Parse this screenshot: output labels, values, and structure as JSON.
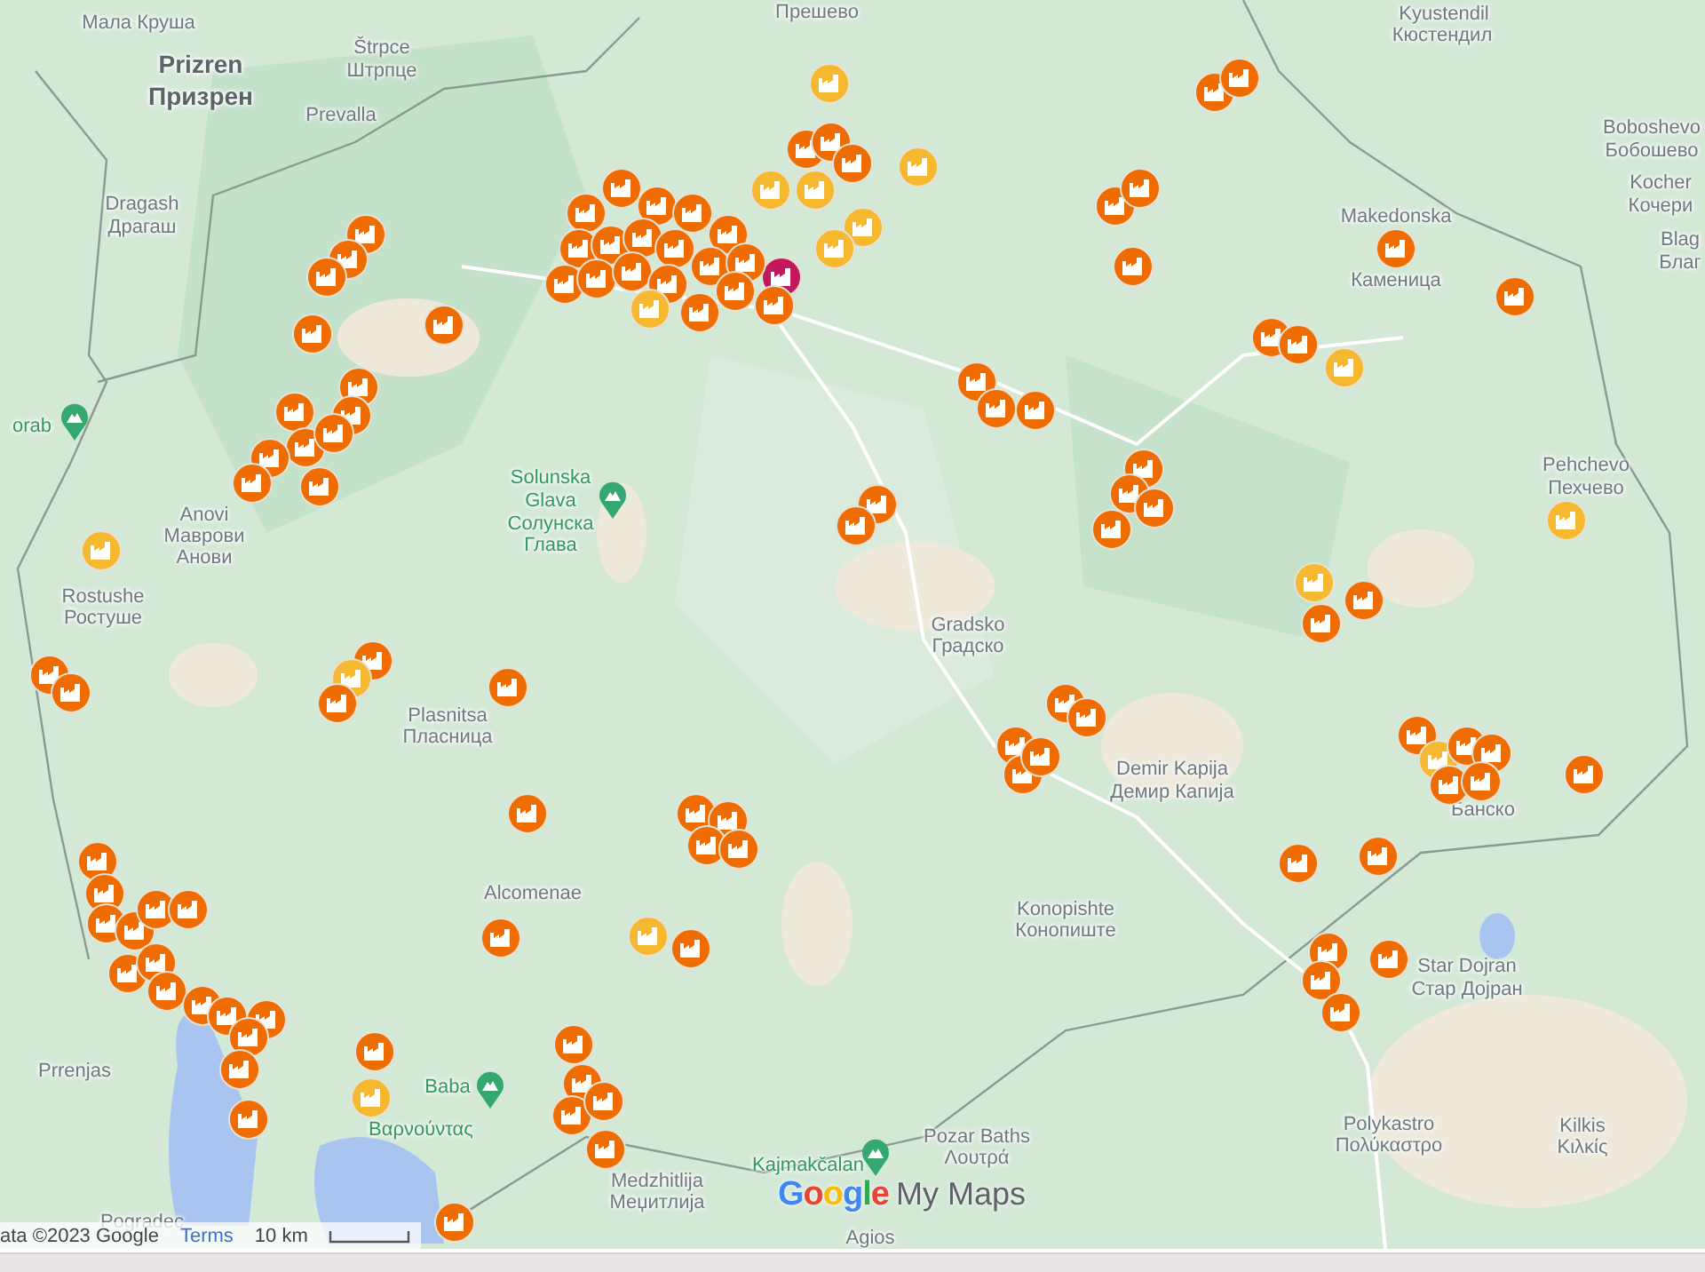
{
  "map": {
    "labels": [
      {
        "text": "Мала Круша",
        "kind": "town"
      },
      {
        "text": "Prizren",
        "kind": "city"
      },
      {
        "text": "Призрен",
        "kind": "city"
      },
      {
        "text": "Štrpce",
        "kind": "town"
      },
      {
        "text": "Штрпце",
        "kind": "town"
      },
      {
        "text": "Prevalla",
        "kind": "town"
      },
      {
        "text": "Прешево",
        "kind": "town"
      },
      {
        "text": "Dragash",
        "kind": "town"
      },
      {
        "text": "Драгаш",
        "kind": "town"
      },
      {
        "text": "orab",
        "kind": "peak"
      },
      {
        "text": "Anovi",
        "kind": "town"
      },
      {
        "text": "Маврови",
        "kind": "town"
      },
      {
        "text": "Анови",
        "kind": "town"
      },
      {
        "text": "Rostushe",
        "kind": "town"
      },
      {
        "text": "Ростуше",
        "kind": "town"
      },
      {
        "text": "Solunska",
        "kind": "peak"
      },
      {
        "text": "Glava",
        "kind": "peak"
      },
      {
        "text": "Солунска",
        "kind": "peak"
      },
      {
        "text": "Глава",
        "kind": "peak"
      },
      {
        "text": "Gradsko",
        "kind": "town"
      },
      {
        "text": "Градско",
        "kind": "town"
      },
      {
        "text": "Plasnitsa",
        "kind": "town"
      },
      {
        "text": "Пласница",
        "kind": "town"
      },
      {
        "text": "Alcomenae",
        "kind": "town"
      },
      {
        "text": "Konopishte",
        "kind": "town"
      },
      {
        "text": "Конопиште",
        "kind": "town"
      },
      {
        "text": "Demir Kapija",
        "kind": "town"
      },
      {
        "text": "Демир Капија",
        "kind": "town"
      },
      {
        "text": "Star Dojran",
        "kind": "town"
      },
      {
        "text": "Стар Дојран",
        "kind": "town"
      },
      {
        "text": "Polykastro",
        "kind": "town"
      },
      {
        "text": "Πολύκαστρο",
        "kind": "town"
      },
      {
        "text": "Kilkis",
        "kind": "town"
      },
      {
        "text": "Κιλκίς",
        "kind": "town"
      },
      {
        "text": "Kyustendil",
        "kind": "town"
      },
      {
        "text": "Кюстендил",
        "kind": "town"
      },
      {
        "text": "Boboshevo",
        "kind": "town"
      },
      {
        "text": "Бобошево",
        "kind": "town"
      },
      {
        "text": "Kocher",
        "kind": "town"
      },
      {
        "text": "Кочери",
        "kind": "town"
      },
      {
        "text": "Blag",
        "kind": "town"
      },
      {
        "text": "Благ",
        "kind": "town"
      },
      {
        "text": "Makedonska",
        "kind": "town"
      },
      {
        "text": "Каменица",
        "kind": "town"
      },
      {
        "text": "Pehchevo",
        "kind": "town"
      },
      {
        "text": "Пехчево",
        "kind": "town"
      },
      {
        "text": "Банско",
        "kind": "town"
      },
      {
        "text": "Prrenjas",
        "kind": "town"
      },
      {
        "text": "Pogradec",
        "kind": "town"
      },
      {
        "text": "Medzhitlija",
        "kind": "town"
      },
      {
        "text": "Меџитлија",
        "kind": "town"
      },
      {
        "text": "Kajmakčalan",
        "kind": "peak"
      },
      {
        "text": "Pozar Baths",
        "kind": "town"
      },
      {
        "text": "Λουτρά",
        "kind": "town"
      },
      {
        "text": "Agios",
        "kind": "town"
      },
      {
        "text": "Baba",
        "kind": "peak"
      },
      {
        "text": "Βαρνούντας",
        "kind": "peak"
      }
    ],
    "markers": [
      {
        "color": "#f5b82e"
      },
      {
        "color": "#ef6c00"
      },
      {
        "color": "#ef6c00"
      },
      {
        "color": "#ef6c00"
      },
      {
        "color": "#ef6c00"
      },
      {
        "color": "#ef6c00"
      },
      {
        "color": "#f5b82e"
      },
      {
        "color": "#f5b82e"
      },
      {
        "color": "#f5b82e"
      },
      {
        "color": "#f5b82e"
      },
      {
        "color": "#f5b82e"
      },
      {
        "color": "#ef6c00"
      },
      {
        "color": "#ef6c00"
      },
      {
        "color": "#ef6c00"
      },
      {
        "color": "#ef6c00"
      },
      {
        "color": "#ef6c00"
      },
      {
        "color": "#c2185b"
      },
      {
        "color": "#ef6c00"
      },
      {
        "color": "#ef6c00"
      },
      {
        "color": "#ef6c00"
      },
      {
        "color": "#ef6c00"
      },
      {
        "color": "#ef6c00"
      },
      {
        "color": "#ef6c00"
      },
      {
        "color": "#ef6c00"
      },
      {
        "color": "#ef6c00"
      },
      {
        "color": "#ef6c00"
      },
      {
        "color": "#ef6c00"
      },
      {
        "color": "#ef6c00"
      },
      {
        "color": "#ef6c00"
      },
      {
        "color": "#ef6c00"
      },
      {
        "color": "#ef6c00"
      },
      {
        "color": "#ef6c00"
      },
      {
        "color": "#f5b82e"
      },
      {
        "color": "#ef6c00"
      },
      {
        "color": "#ef6c00"
      },
      {
        "color": "#ef6c00"
      },
      {
        "color": "#ef6c00"
      },
      {
        "color": "#ef6c00"
      },
      {
        "color": "#ef6c00"
      },
      {
        "color": "#ef6c00"
      },
      {
        "color": "#ef6c00"
      },
      {
        "color": "#ef6c00"
      },
      {
        "color": "#ef6c00"
      },
      {
        "color": "#ef6c00"
      },
      {
        "color": "#ef6c00"
      },
      {
        "color": "#ef6c00"
      },
      {
        "color": "#ef6c00"
      },
      {
        "color": "#ef6c00"
      },
      {
        "color": "#ef6c00"
      },
      {
        "color": "#f5b82e"
      },
      {
        "color": "#ef6c00"
      },
      {
        "color": "#ef6c00"
      },
      {
        "color": "#f5b82e"
      },
      {
        "color": "#ef6c00"
      },
      {
        "color": "#ef6c00"
      },
      {
        "color": "#ef6c00"
      },
      {
        "color": "#ef6c00"
      },
      {
        "color": "#ef6c00"
      },
      {
        "color": "#ef6c00"
      },
      {
        "color": "#ef6c00"
      },
      {
        "color": "#ef6c00"
      },
      {
        "color": "#ef6c00"
      },
      {
        "color": "#f5b82e"
      },
      {
        "color": "#f5b82e"
      },
      {
        "color": "#ef6c00"
      },
      {
        "color": "#ef6c00"
      },
      {
        "color": "#ef6c00"
      },
      {
        "color": "#ef6c00"
      },
      {
        "color": "#ef6c00"
      },
      {
        "color": "#f5b82e"
      },
      {
        "color": "#ef6c00"
      },
      {
        "color": "#ef6c00"
      },
      {
        "color": "#ef6c00"
      },
      {
        "color": "#ef6c00"
      },
      {
        "color": "#ef6c00"
      },
      {
        "color": "#ef6c00"
      },
      {
        "color": "#ef6c00"
      },
      {
        "color": "#ef6c00"
      },
      {
        "color": "#f5b82e"
      },
      {
        "color": "#ef6c00"
      },
      {
        "color": "#ef6c00"
      },
      {
        "color": "#ef6c00"
      },
      {
        "color": "#ef6c00"
      },
      {
        "color": "#ef6c00"
      },
      {
        "color": "#ef6c00"
      },
      {
        "color": "#ef6c00"
      },
      {
        "color": "#ef6c00"
      },
      {
        "color": "#ef6c00"
      },
      {
        "color": "#ef6c00"
      },
      {
        "color": "#ef6c00"
      },
      {
        "color": "#ef6c00"
      },
      {
        "color": "#ef6c00"
      },
      {
        "color": "#ef6c00"
      },
      {
        "color": "#ef6c00"
      },
      {
        "color": "#ef6c00"
      },
      {
        "color": "#ef6c00"
      },
      {
        "color": "#ef6c00"
      },
      {
        "color": "#ef6c00"
      },
      {
        "color": "#ef6c00"
      },
      {
        "color": "#ef6c00"
      },
      {
        "color": "#ef6c00"
      },
      {
        "color": "#f5b82e"
      },
      {
        "color": "#ef6c00"
      },
      {
        "color": "#ef6c00"
      },
      {
        "color": "#ef6c00"
      },
      {
        "color": "#ef6c00"
      },
      {
        "color": "#ef6c00"
      },
      {
        "color": "#ef6c00"
      },
      {
        "color": "#ef6c00"
      },
      {
        "color": "#ef6c00"
      },
      {
        "color": "#ef6c00"
      },
      {
        "color": "#ef6c00"
      },
      {
        "color": "#ef6c00"
      },
      {
        "color": "#ef6c00"
      },
      {
        "color": "#f5b82e"
      },
      {
        "color": "#ef6c00"
      },
      {
        "color": "#ef6c00"
      },
      {
        "color": "#ef6c00"
      },
      {
        "color": "#ef6c00"
      },
      {
        "color": "#ef6c00"
      },
      {
        "color": "#ef6c00"
      }
    ],
    "logo": {
      "brand": "Google",
      "product": "My Maps"
    },
    "attribution": {
      "copyright": "ata ©2023 Google",
      "terms": "Terms",
      "scale": "10 km"
    }
  }
}
